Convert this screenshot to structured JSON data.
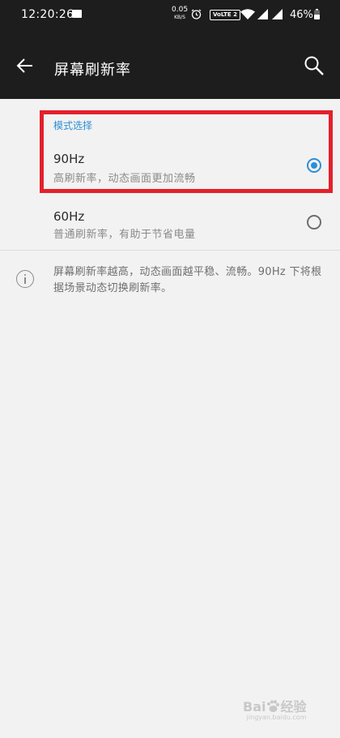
{
  "status_bar": {
    "time": "12:20:26",
    "net_speed_value": "0.05",
    "net_speed_unit": "KB/S",
    "volte": "VoLTE 2",
    "battery": "46%"
  },
  "app_bar": {
    "title": "屏幕刷新率",
    "back_icon": "back-arrow-icon",
    "search_icon": "search-icon"
  },
  "section": {
    "header": "模式选择"
  },
  "options": [
    {
      "name": "90Hz",
      "description": "高刷新率，动态画面更加流畅",
      "selected": true
    },
    {
      "name": "60Hz",
      "description": "普通刷新率，有助于节省电量",
      "selected": false
    }
  ],
  "info": {
    "text": "屏幕刷新率越高，动态画面越平稳、流畅。90Hz 下将根据场景动态切换刷新率。"
  },
  "watermark": {
    "brand": "Bai",
    "brand2": "经验",
    "url": "jingyan.baidu.com"
  },
  "colors": {
    "accent": "#2d8fd6",
    "highlight": "#e3202b",
    "app_bar_bg": "#1d1d1d",
    "page_bg": "#f2f2f2"
  }
}
